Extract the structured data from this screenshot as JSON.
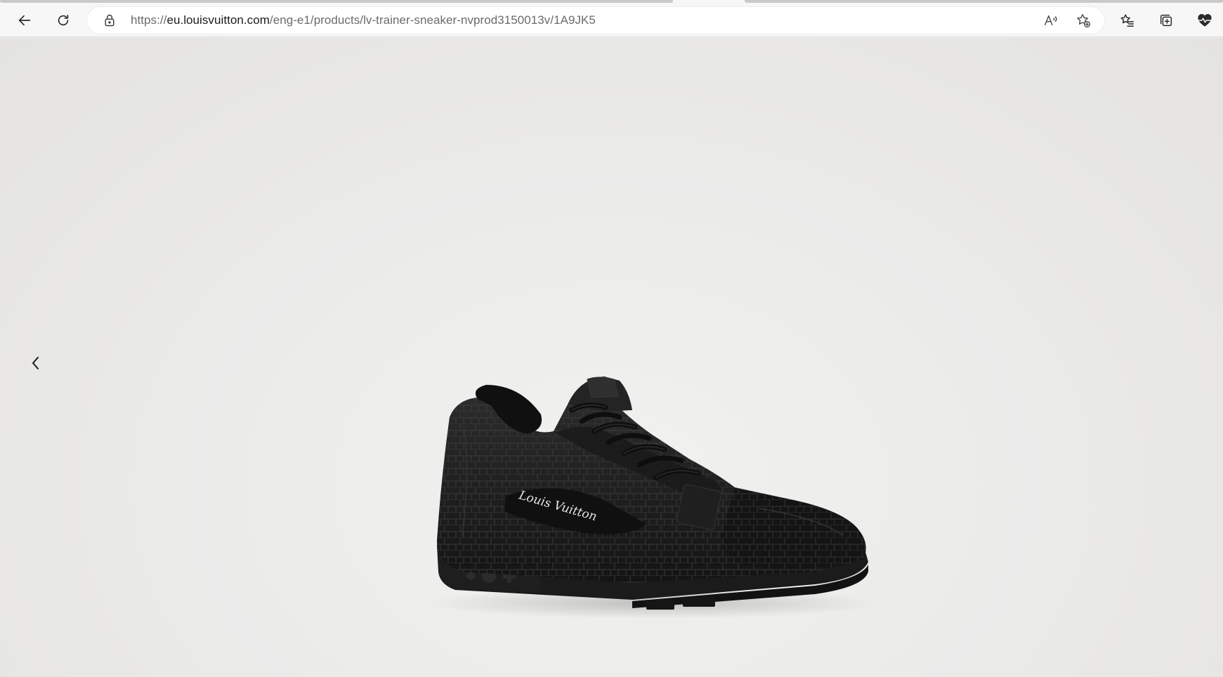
{
  "browser": {
    "address_bar": {
      "url_scheme": "https://",
      "url_domain": "eu.louisvuitton.com",
      "url_path": "/eng-e1/products/lv-trainer-sneaker-nvprod3150013v/1A9JK5"
    },
    "icons": {
      "back": "back-arrow-icon",
      "refresh": "refresh-icon",
      "lock": "lock-icon",
      "read_aloud": "read-aloud-icon",
      "add_favorite": "add-favorite-star-icon",
      "favorites": "favorites-list-icon",
      "collections": "collections-icon",
      "health": "browser-essentials-heart-icon"
    }
  },
  "page": {
    "carousel": {
      "prev_icon": "chevron-left-icon",
      "image": {
        "subject": "black-sneaker",
        "logo_script": "Louis Vuitton"
      }
    }
  },
  "colors": {
    "toolbar_bg": "#f7f7f7",
    "page_bg": "#ebebea",
    "shoe": "#1c1c1c"
  }
}
